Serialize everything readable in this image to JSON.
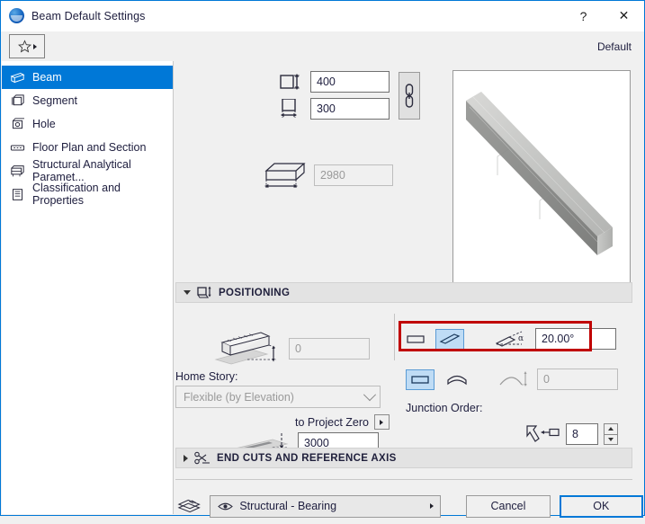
{
  "window": {
    "title": "Beam Default Settings",
    "logo_icon": "archicad-logo-icon",
    "help_label": "?",
    "close_label": "✕"
  },
  "toolbar": {
    "favorites_icon": "star-icon",
    "favorites_caret": "caret-right-icon",
    "default_label": "Default"
  },
  "sidebar": {
    "items": [
      {
        "label": "Beam",
        "icon": "beam-icon",
        "selected": true
      },
      {
        "label": "Segment",
        "icon": "segment-icon",
        "selected": false
      },
      {
        "label": "Hole",
        "icon": "hole-icon",
        "selected": false
      },
      {
        "label": "Floor Plan and Section",
        "icon": "floor-plan-section-icon",
        "selected": false
      },
      {
        "label": "Structural Analytical Paramet...",
        "icon": "structural-analytical-icon",
        "selected": false
      },
      {
        "label": "Classification and Properties",
        "icon": "classification-properties-icon",
        "selected": false
      }
    ]
  },
  "geometry": {
    "height_icon": "beam-height-icon",
    "height_value": "400",
    "width_icon": "beam-width-icon",
    "width_value": "300",
    "link_icon": "chain-link-icon",
    "length_icon": "beam-length-icon",
    "length_value": "2980",
    "preview_icon": "beam-3d-preview"
  },
  "positioning": {
    "section_title": "POSITIONING",
    "section_icon": "positioning-icon",
    "elevation_icon": "beam-elevation-icon",
    "elevation_value": "0",
    "home_story_label": "Home Story:",
    "home_story_value": "Flexible (by Elevation)",
    "to_project_zero_label": "to Project Zero",
    "project_zero_value": "3000",
    "project_zero_icon": "project-zero-icon",
    "rotation_flat_icon": "beam-flat-icon",
    "rotation_tilted_icon": "beam-rotated-icon",
    "angle_icon": "beam-angle-icon",
    "angle_value": "20.00°",
    "straight_icon": "straight-beam-icon",
    "curved_icon": "curved-beam-icon",
    "radius_icon": "arc-radius-icon",
    "radius_value": "0",
    "junction_order_label": "Junction Order:",
    "junction_order_icon": "junction-order-icon",
    "junction_order_value": "8"
  },
  "end_cuts": {
    "section_title": "END CUTS AND REFERENCE AXIS",
    "section_icon": "scissors-icon"
  },
  "footer": {
    "layers_icon": "layers-stack-icon",
    "eye_icon": "eye-icon",
    "layer_value": "Structural - Bearing",
    "layer_caret": "caret-right-icon",
    "cancel_label": "Cancel",
    "ok_label": "OK"
  },
  "colors": {
    "accent": "#0078d7",
    "highlight_red": "#c00000",
    "toggle_on": "#bfdcf5"
  }
}
